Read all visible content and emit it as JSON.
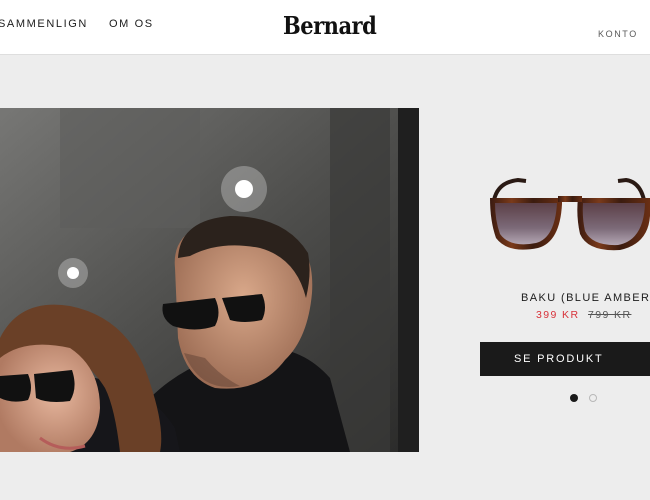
{
  "header": {
    "nav": {
      "compare_label": "SAMMENLIGN",
      "about_label": "OM OS"
    },
    "logo_text": "Bernard",
    "account_label": "KONTO"
  },
  "hero": {
    "image_description_icon": "couple-wearing-sunglasses-photo",
    "hotspots": [
      "hotspot-man-sunglasses",
      "hotspot-woman-sunglasses"
    ]
  },
  "product": {
    "image_icon": "sunglasses-tortoise-icon",
    "name": "BAKU (BLUE AMBER)",
    "price_current": "399 KR",
    "price_original": "799 KR",
    "cta_label": "SE PRODUKT",
    "carousel": {
      "total": 2,
      "active": 1
    }
  },
  "colors": {
    "background": "#ededed",
    "header": "#ffffff",
    "text": "#1c1c1c",
    "price_sale": "#d8323a",
    "button": "#1a1a1a"
  }
}
